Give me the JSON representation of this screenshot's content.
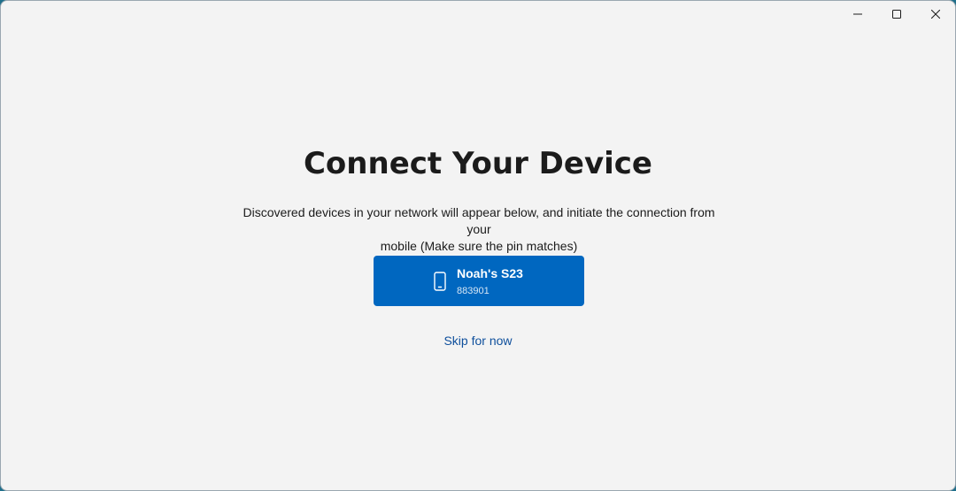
{
  "window": {
    "controls": {
      "minimize_icon": "minimize-icon",
      "maximize_icon": "maximize-icon",
      "close_icon": "close-icon"
    }
  },
  "main": {
    "title": "Connect Your Device",
    "description_line1": "Discovered devices in your network will appear below, and initiate the connection from your",
    "description_line2": "mobile (Make sure the pin matches)",
    "devices": [
      {
        "name": "Noah's S23",
        "pin": "883901",
        "icon": "phone-icon"
      }
    ],
    "skip_label": "Skip for now"
  },
  "colors": {
    "background": "#f3f3f3",
    "accent": "#0067c0",
    "link": "#0e4f9c",
    "text": "#1b1b1b"
  }
}
